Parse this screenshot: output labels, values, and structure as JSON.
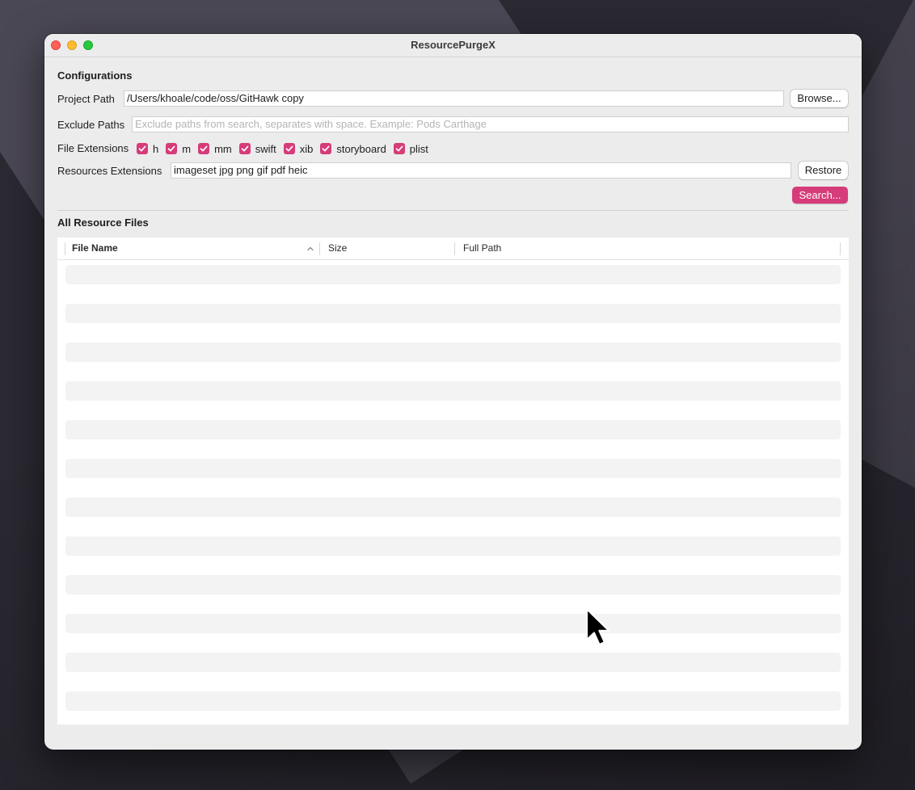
{
  "window": {
    "title": "ResourcePurgeX"
  },
  "configurations": {
    "heading": "Configurations",
    "project_path": {
      "label": "Project Path",
      "value": "/Users/khoale/code/oss/GitHawk copy",
      "browse_label": "Browse..."
    },
    "exclude_paths": {
      "label": "Exclude Paths",
      "value": "",
      "placeholder": "Exclude paths from search, separates with space. Example: Pods Carthage"
    },
    "file_extensions": {
      "label": "File Extensions",
      "items": [
        {
          "label": "h",
          "checked": true
        },
        {
          "label": "m",
          "checked": true
        },
        {
          "label": "mm",
          "checked": true
        },
        {
          "label": "swift",
          "checked": true
        },
        {
          "label": "xib",
          "checked": true
        },
        {
          "label": "storyboard",
          "checked": true
        },
        {
          "label": "plist",
          "checked": true
        }
      ]
    },
    "resources_extensions": {
      "label": "Resources Extensions",
      "value": "imageset jpg png gif pdf heic",
      "restore_label": "Restore"
    },
    "search_label": "Search..."
  },
  "results": {
    "heading": "All Resource Files",
    "columns": [
      "File Name",
      "Size",
      "Full Path"
    ],
    "sort_column": "File Name",
    "sort_direction": "ascending",
    "rows": []
  },
  "colors": {
    "accent": "#d63c79",
    "window_bg": "#ececec",
    "row_stripe": "#f3f3f3"
  }
}
